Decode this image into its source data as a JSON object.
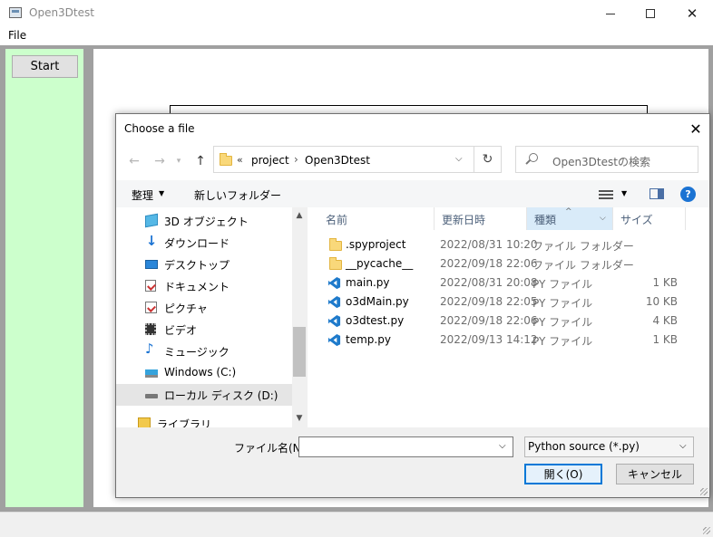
{
  "window": {
    "title": "Open3Dtest"
  },
  "menu": {
    "file": "File"
  },
  "sidebar": {
    "start_button": "Start"
  },
  "dialog": {
    "title": "Choose a file",
    "address": {
      "chevron": "«",
      "crumbs": [
        "project",
        "Open3Dtest"
      ]
    },
    "search_placeholder": "Open3Dtestの検索",
    "toolbar": {
      "organize": "整理",
      "new_folder": "新しいフォルダー"
    },
    "nav_items": [
      {
        "label": "3D オブジェクト",
        "icon": "3d-objects-icon"
      },
      {
        "label": "ダウンロード",
        "icon": "download-icon"
      },
      {
        "label": "デスクトップ",
        "icon": "desktop-icon"
      },
      {
        "label": "ドキュメント",
        "icon": "documents-icon"
      },
      {
        "label": "ピクチャ",
        "icon": "pictures-icon"
      },
      {
        "label": "ビデオ",
        "icon": "video-icon"
      },
      {
        "label": "ミュージック",
        "icon": "music-icon"
      },
      {
        "label": "Windows (C:)",
        "icon": "windows-drive-icon"
      },
      {
        "label": "ローカル ディスク (D:)",
        "icon": "local-disk-icon",
        "selected": true
      },
      {
        "label": "ライブラリ",
        "icon": "library-icon"
      }
    ],
    "columns": {
      "name": "名前",
      "date": "更新日時",
      "type": "種類",
      "size": "サイズ"
    },
    "files": [
      {
        "name": ".spyproject",
        "date": "2022/08/31 10:20",
        "type": "ファイル フォルダー",
        "size": "",
        "icon": "folder-icon"
      },
      {
        "name": "__pycache__",
        "date": "2022/09/18 22:06",
        "type": "ファイル フォルダー",
        "size": "",
        "icon": "folder-icon"
      },
      {
        "name": "main.py",
        "date": "2022/08/31 20:08",
        "type": "PY ファイル",
        "size": "1 KB",
        "icon": "vscode-file-icon"
      },
      {
        "name": "o3dMain.py",
        "date": "2022/09/18 22:05",
        "type": "PY ファイル",
        "size": "10 KB",
        "icon": "vscode-file-icon"
      },
      {
        "name": "o3dtest.py",
        "date": "2022/09/18 22:06",
        "type": "PY ファイル",
        "size": "4 KB",
        "icon": "vscode-file-icon"
      },
      {
        "name": "temp.py",
        "date": "2022/09/13 14:12",
        "type": "PY ファイル",
        "size": "1 KB",
        "icon": "vscode-file-icon"
      }
    ],
    "filename_label": "ファイル名(N):",
    "filename_value": "",
    "filetype": "Python source (*.py)",
    "open_button": "開く(O)",
    "cancel_button": "キャンセル"
  },
  "colors": {
    "left_panel": "#ccffcc",
    "accent": "#0078d7"
  }
}
